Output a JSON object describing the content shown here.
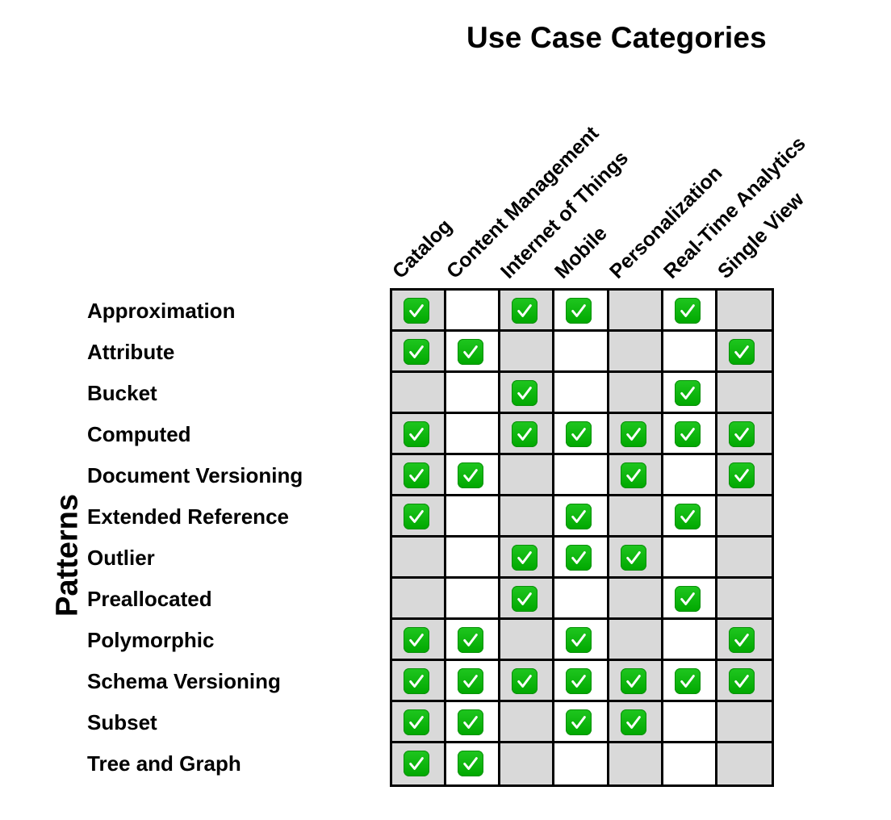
{
  "chart_data": {
    "type": "table",
    "title": "Use Case Categories",
    "xlabel": "Use Case Categories",
    "ylabel": "Patterns",
    "columns": [
      "Catalog",
      "Content Management",
      "Internet of Things",
      "Mobile",
      "Personalization",
      "Real-Time Analytics",
      "Single View"
    ],
    "column_shading": [
      "gray",
      "white",
      "gray",
      "white",
      "gray",
      "white",
      "gray"
    ],
    "rows": [
      {
        "label": "Approximation",
        "values": [
          1,
          0,
          1,
          1,
          0,
          1,
          0
        ]
      },
      {
        "label": "Attribute",
        "values": [
          1,
          1,
          0,
          0,
          0,
          0,
          1
        ]
      },
      {
        "label": "Bucket",
        "values": [
          0,
          0,
          1,
          0,
          0,
          1,
          0
        ]
      },
      {
        "label": "Computed",
        "values": [
          1,
          0,
          1,
          1,
          1,
          1,
          1
        ]
      },
      {
        "label": "Document Versioning",
        "values": [
          1,
          1,
          0,
          0,
          1,
          0,
          1
        ]
      },
      {
        "label": "Extended Reference",
        "values": [
          1,
          0,
          0,
          1,
          0,
          1,
          0
        ]
      },
      {
        "label": "Outlier",
        "values": [
          0,
          0,
          1,
          1,
          1,
          0,
          0
        ]
      },
      {
        "label": "Preallocated",
        "values": [
          0,
          0,
          1,
          0,
          0,
          1,
          0
        ]
      },
      {
        "label": "Polymorphic",
        "values": [
          1,
          1,
          0,
          1,
          0,
          0,
          1
        ]
      },
      {
        "label": "Schema Versioning",
        "values": [
          1,
          1,
          1,
          1,
          1,
          1,
          1
        ]
      },
      {
        "label": "Subset",
        "values": [
          1,
          1,
          0,
          1,
          1,
          0,
          0
        ]
      },
      {
        "label": "Tree and Graph",
        "values": [
          1,
          1,
          0,
          0,
          0,
          0,
          0
        ]
      }
    ],
    "marker": "check-mark-icon",
    "colors": {
      "gray_cell": "#d9d9d9",
      "white_cell": "#ffffff",
      "check": "#00b000",
      "border": "#000000"
    }
  }
}
